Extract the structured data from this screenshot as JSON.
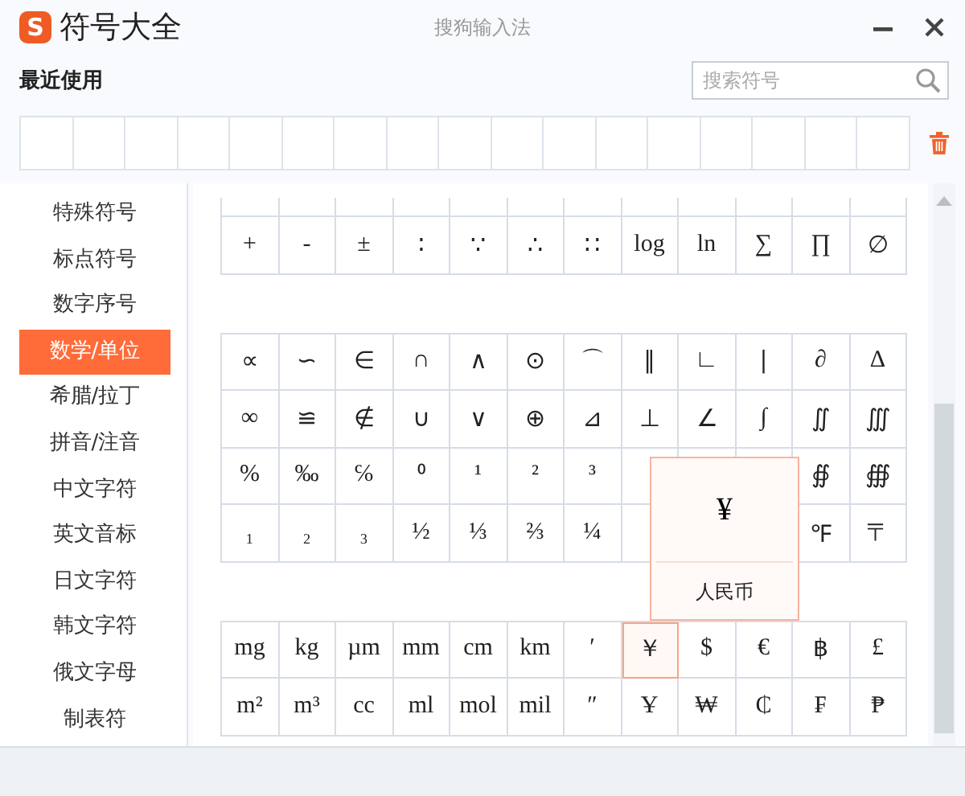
{
  "app": {
    "logo": "S",
    "title": "符号大全",
    "subtitle": "搜狗输入法"
  },
  "recent": {
    "label": "最近使用"
  },
  "search": {
    "placeholder": "搜索符号"
  },
  "categories": [
    {
      "label": "特殊符号",
      "selected": false
    },
    {
      "label": "标点符号",
      "selected": false
    },
    {
      "label": "数字序号",
      "selected": false
    },
    {
      "label": "数学/单位",
      "selected": true
    },
    {
      "label": "希腊/拉丁",
      "selected": false
    },
    {
      "label": "拼音/注音",
      "selected": false
    },
    {
      "label": "中文字符",
      "selected": false
    },
    {
      "label": "英文音标",
      "selected": false
    },
    {
      "label": "日文字符",
      "selected": false
    },
    {
      "label": "韩文字符",
      "selected": false
    },
    {
      "label": "俄文字母",
      "selected": false
    },
    {
      "label": "制表符",
      "selected": false
    }
  ],
  "groups": [
    {
      "rows": [
        [
          {
            "symbol": "+",
            "selected": false
          },
          {
            "symbol": "-",
            "selected": false
          },
          {
            "symbol": "±",
            "selected": false
          },
          {
            "symbol": "∶",
            "selected": false
          },
          {
            "symbol": "∵",
            "selected": false
          },
          {
            "symbol": "∴",
            "selected": false
          },
          {
            "symbol": "∷",
            "selected": false
          },
          {
            "symbol": "log",
            "selected": false
          },
          {
            "symbol": "ln",
            "selected": false
          },
          {
            "symbol": "∑",
            "selected": false
          },
          {
            "symbol": "∏",
            "selected": false
          },
          {
            "symbol": "∅",
            "selected": false
          }
        ]
      ]
    },
    {
      "rows": [
        [
          {
            "symbol": "∝",
            "selected": false
          },
          {
            "symbol": "∽",
            "selected": false
          },
          {
            "symbol": "∈",
            "selected": false
          },
          {
            "symbol": "∩",
            "selected": false
          },
          {
            "symbol": "∧",
            "selected": false
          },
          {
            "symbol": "⊙",
            "selected": false
          },
          {
            "symbol": "⌒",
            "selected": false
          },
          {
            "symbol": "∥",
            "selected": false
          },
          {
            "symbol": "∟",
            "selected": false
          },
          {
            "symbol": "∣",
            "selected": false
          },
          {
            "symbol": "∂",
            "selected": false
          },
          {
            "symbol": "∆",
            "selected": false
          }
        ],
        [
          {
            "symbol": "∞",
            "selected": false
          },
          {
            "symbol": "≌",
            "selected": false
          },
          {
            "symbol": "∉",
            "selected": false
          },
          {
            "symbol": "∪",
            "selected": false
          },
          {
            "symbol": "∨",
            "selected": false
          },
          {
            "symbol": "⊕",
            "selected": false
          },
          {
            "symbol": "⊿",
            "selected": false
          },
          {
            "symbol": "⊥",
            "selected": false
          },
          {
            "symbol": "∠",
            "selected": false
          },
          {
            "symbol": "∫",
            "selected": false
          },
          {
            "symbol": "∬",
            "selected": false
          },
          {
            "symbol": "∭",
            "selected": false
          }
        ],
        [
          {
            "symbol": "%",
            "selected": false
          },
          {
            "symbol": "‰",
            "selected": false
          },
          {
            "symbol": "℅",
            "selected": false
          },
          {
            "symbol": "⁰",
            "selected": false
          },
          {
            "symbol": "¹",
            "selected": false
          },
          {
            "symbol": "²",
            "selected": false
          },
          {
            "symbol": "³",
            "selected": false
          },
          {
            "selected": false
          },
          {},
          {},
          {
            "symbol": "∯",
            "selected": false
          },
          {
            "symbol": "∰",
            "selected": false
          }
        ],
        [
          {
            "symbol": "₁",
            "selected": false
          },
          {
            "symbol": "₂",
            "selected": false
          },
          {
            "symbol": "₃",
            "selected": false
          },
          {
            "symbol": "½",
            "selected": false
          },
          {
            "symbol": "⅓",
            "selected": false
          },
          {
            "symbol": "⅔",
            "selected": false
          },
          {
            "symbol": "¼",
            "selected": false
          },
          {
            "selected": false
          },
          {},
          {},
          {
            "symbol": "℉",
            "selected": false
          },
          {
            "symbol": "〒",
            "selected": false
          }
        ]
      ]
    },
    {
      "rows": [
        [
          {
            "symbol": "mg",
            "selected": false
          },
          {
            "symbol": "kg",
            "selected": false
          },
          {
            "symbol": "µm",
            "selected": false
          },
          {
            "symbol": "mm",
            "selected": false
          },
          {
            "symbol": "cm",
            "selected": false
          },
          {
            "symbol": "km",
            "selected": false
          },
          {
            "symbol": "′",
            "selected": false
          },
          {
            "symbol": "￥",
            "selected": true
          },
          {
            "symbol": "$",
            "selected": false
          },
          {
            "symbol": "€",
            "selected": false
          },
          {
            "symbol": "฿",
            "selected": false
          },
          {
            "symbol": "£",
            "selected": false
          }
        ],
        [
          {
            "symbol": "m²",
            "selected": false
          },
          {
            "symbol": "m³",
            "selected": false
          },
          {
            "symbol": "cc",
            "selected": false
          },
          {
            "symbol": "ml",
            "selected": false
          },
          {
            "symbol": "mol",
            "selected": false
          },
          {
            "symbol": "mil",
            "selected": false
          },
          {
            "symbol": "″",
            "selected": false
          },
          {
            "symbol": "Ұ",
            "selected": false
          },
          {
            "symbol": "₩",
            "selected": false
          },
          {
            "symbol": "₵",
            "selected": false
          },
          {
            "symbol": "₣",
            "selected": false
          },
          {
            "symbol": "₱",
            "selected": false
          }
        ]
      ],
      "tooltip": {
        "symbol": "¥",
        "name": "人民币"
      }
    }
  ]
}
